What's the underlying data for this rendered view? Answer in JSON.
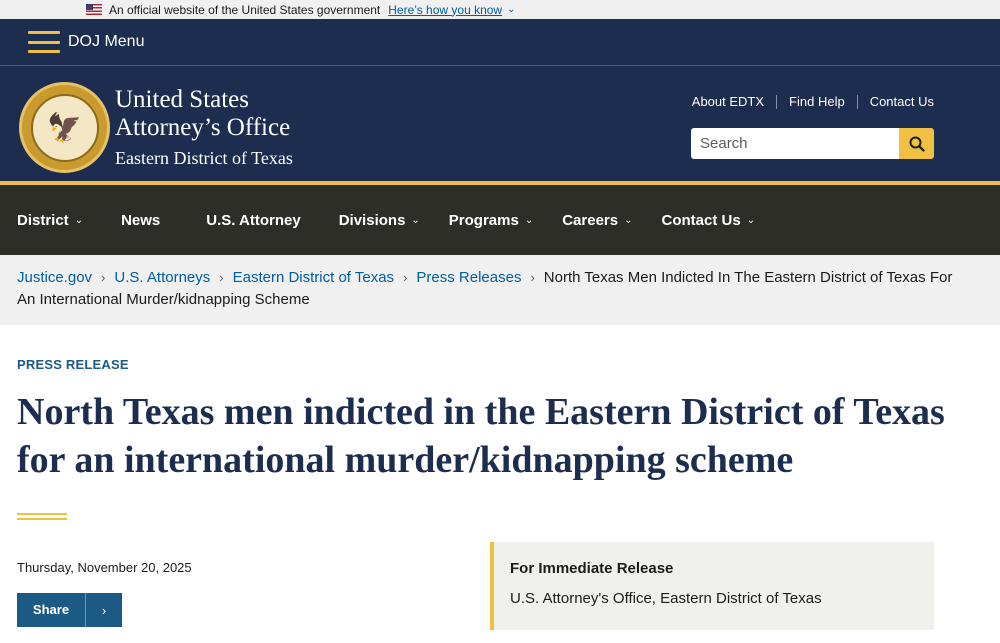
{
  "gov_banner": {
    "text": "An official website of the United States government",
    "link": "Here’s how you know",
    "chevron": "⌄"
  },
  "doj_menu": {
    "label": "DOJ Menu"
  },
  "header": {
    "seal_alt": "Department of Justice seal",
    "name_line1": "United States",
    "name_line2": "Attorney’s Office",
    "name_line3": "Eastern District of Texas",
    "util_links": [
      "About EDTX",
      "Find Help",
      "Contact Us"
    ],
    "search_placeholder": "Search"
  },
  "nav": {
    "items": [
      {
        "label": "District",
        "caret": "⌄"
      },
      {
        "label": "News",
        "caret": ""
      },
      {
        "label": "U.S. Attorney",
        "caret": ""
      },
      {
        "label": "Divisions",
        "caret": "⌄"
      },
      {
        "label": "Programs",
        "caret": "⌄"
      },
      {
        "label": "Careers",
        "caret": "⌄"
      },
      {
        "label": "Contact Us",
        "caret": "⌄"
      }
    ]
  },
  "breadcrumb": {
    "items": [
      "Justice.gov",
      "U.S. Attorneys",
      "Eastern District of Texas",
      "Press Releases"
    ],
    "separator": "›",
    "current": "North Texas Men Indicted In The Eastern District of Texas For An International Murder/kidnapping Scheme"
  },
  "article": {
    "kicker": "PRESS RELEASE",
    "headline": "North Texas men indicted in the Eastern District of Texas for an international murder/kidnapping scheme",
    "date": "Thursday, November 20, 2025",
    "share_label": "Share",
    "share_arrow": "›",
    "release_title": "For Immediate Release",
    "release_office": "U.S. Attorney's Office, Eastern District of Texas"
  },
  "colors": {
    "navy": "#1c2d4f",
    "gold": "#f0c042",
    "nav_dark": "#2e2e29",
    "link_blue": "#005ea2",
    "share_blue": "#1a5a85"
  },
  "icons": {
    "flag": "us-flag-icon",
    "menu": "hamburger-icon",
    "search": "search-icon",
    "seal": "doj-seal-icon",
    "caret": "chevron-down-icon",
    "share_arrow": "chevron-right-icon"
  }
}
